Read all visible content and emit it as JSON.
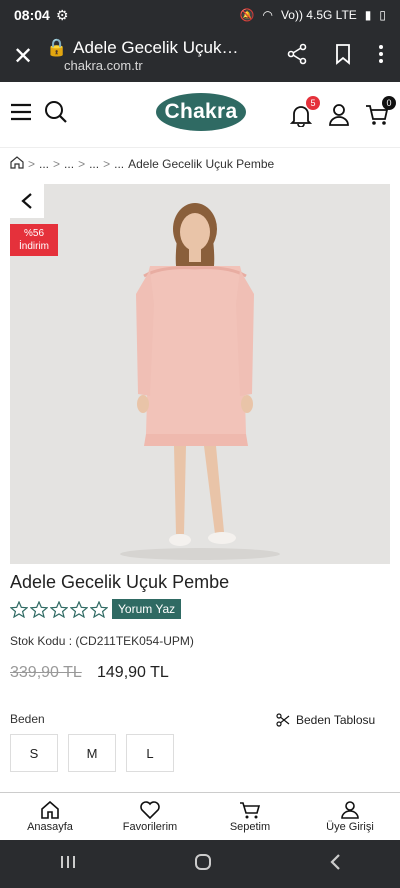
{
  "status_bar": {
    "time": "08:04",
    "network": "Vo)) 4.5G LTE"
  },
  "browser": {
    "page_title": "Adele Gecelik Uçuk Pembe",
    "domain": "chakra.com.tr"
  },
  "header": {
    "logo_text": "Chakra",
    "notification_count": "5",
    "cart_count": "0"
  },
  "breadcrumb": {
    "items": [
      "...",
      "...",
      "...",
      "..."
    ],
    "current": "Adele Gecelik Uçuk Pembe"
  },
  "product": {
    "discount_badge": {
      "percent": "%56",
      "label": "İndirim"
    },
    "title": "Adele Gecelik Uçuk Pembe",
    "review_label": "Yorum Yaz",
    "sku": "Stok Kodu :  (CD211TEK054-UPM)",
    "old_price": "339,90 TL",
    "new_price": "149,90 TL",
    "size_label": "Beden",
    "size_chart_label": "Beden Tablosu",
    "sizes": [
      "S",
      "M",
      "L"
    ],
    "rating": 0
  },
  "bottom_nav": [
    "Anasayfa",
    "Favorilerim",
    "Sepetim",
    "Üye Girişi"
  ],
  "colors": {
    "brand": "#2f6a63",
    "discount": "#e5313b",
    "system_bar": "#2a2c2f"
  }
}
